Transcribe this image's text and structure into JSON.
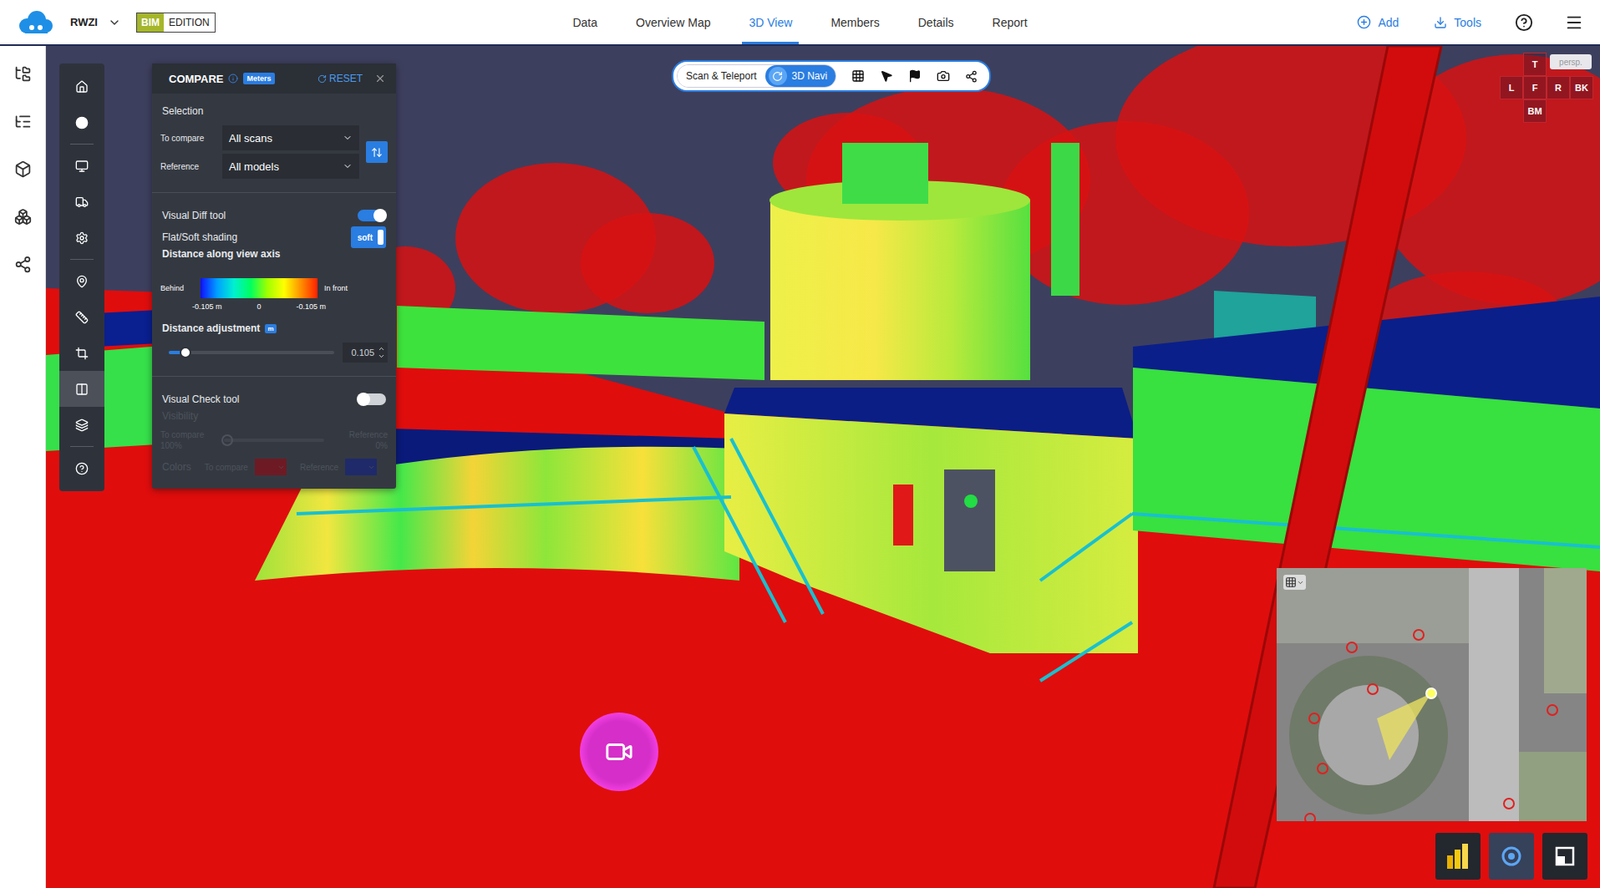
{
  "header": {
    "project": "RWZI",
    "edition_badge": "BIM",
    "edition_label": "EDITION"
  },
  "nav": [
    {
      "label": "Data",
      "selected": false
    },
    {
      "label": "Overview Map",
      "selected": false
    },
    {
      "label": "3D View",
      "selected": true
    },
    {
      "label": "Members",
      "selected": false
    },
    {
      "label": "Details",
      "selected": false
    },
    {
      "label": "Report",
      "selected": false
    }
  ],
  "actions": [
    {
      "label": "Add"
    },
    {
      "label": "Tools"
    }
  ],
  "side_tools": [
    {
      "selected": false
    },
    {
      "selected": false
    },
    {
      "selected": false
    },
    {
      "selected": false
    },
    {
      "selected": false
    },
    {
      "selected": false
    },
    {
      "selected": false
    },
    {
      "selected": false
    },
    {
      "selected": true
    },
    {
      "selected": false
    },
    {
      "selected": false
    }
  ],
  "viewer_toolbar": {
    "modes": [
      {
        "label": "Scan & Teleport",
        "selected": false
      },
      {
        "label": "3D Navi",
        "selected": true
      }
    ]
  },
  "view_cube": {
    "top": "T",
    "projection": "persp.",
    "sides": [
      "L",
      "F",
      "R",
      "BK"
    ],
    "bim": "BM"
  },
  "compare": {
    "title": "COMPARE",
    "unit_badge": "Meters",
    "reset": "RESET",
    "selection_label": "Selection",
    "selects": [
      {
        "label": "To compare",
        "value": "All scans"
      },
      {
        "label": "Reference",
        "value": "All models"
      }
    ],
    "visual_diff": {
      "label": "Visual Diff tool",
      "on": true
    },
    "shading": {
      "label": "Flat/Soft shading",
      "value": "soft",
      "on": true
    },
    "legend": {
      "title": "Distance along view axis",
      "left": "Behind",
      "right": "In front",
      "ticks": [
        "-0.105 m",
        "0",
        "-0.105 m"
      ]
    },
    "distance": {
      "label": "Distance adjustment",
      "unit": "m",
      "level": 0.1,
      "value": "0.105"
    },
    "visual_check": {
      "label": "Visual Check tool",
      "on": false
    },
    "visibility": {
      "label": "Visibility",
      "disabled": true,
      "left_label": "To compare",
      "left_value": "100%",
      "right_label": "Reference",
      "right_value": "0%",
      "level": 0
    },
    "colors": {
      "label": "Colors",
      "disabled": true,
      "items": [
        {
          "label": "To compare",
          "color": "#6e1a24"
        },
        {
          "label": "Reference",
          "color": "#1f2a6a"
        }
      ]
    }
  }
}
